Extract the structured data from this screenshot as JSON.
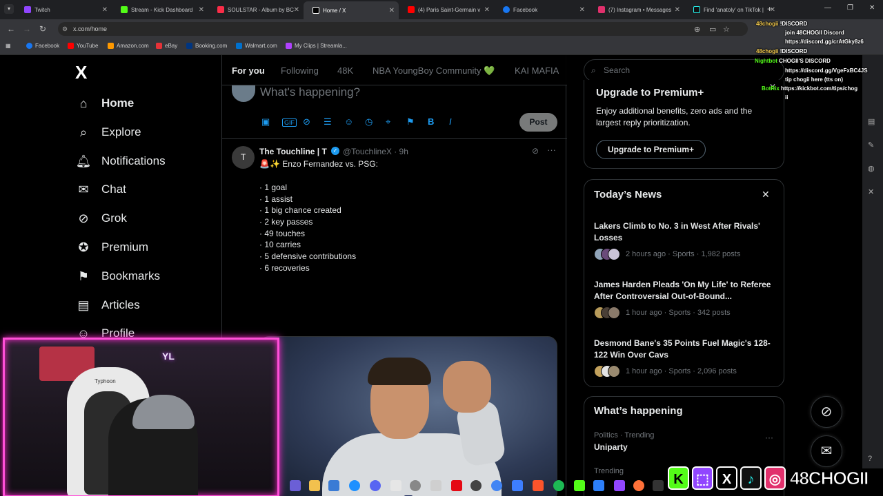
{
  "browser": {
    "tabs": [
      {
        "label": "Twitch",
        "color": "#9146ff"
      },
      {
        "label": "Stream - Kick Dashboard",
        "color": "#53fc18"
      },
      {
        "label": "SOULSTAR - Album by BC",
        "color": "#fa2d48"
      },
      {
        "label": "Home / X",
        "color": "#ffffff"
      },
      {
        "label": "(4) Paris Saint-Germain v",
        "color": "#ff0000"
      },
      {
        "label": "Facebook",
        "color": "#1877f2"
      },
      {
        "label": "(7) Instagram • Messages",
        "color": "#e1306c"
      },
      {
        "label": "Find 'anatoly' on TikTok |",
        "color": "#25f4ee"
      }
    ],
    "url": "x.com/home",
    "bookmarks": [
      {
        "label": "Facebook",
        "color": "#1877f2"
      },
      {
        "label": "YouTube",
        "color": "#ff0000"
      },
      {
        "label": "Amazon.com",
        "color": "#ff9900"
      },
      {
        "label": "eBay",
        "color": "#e53238"
      },
      {
        "label": "Booking.com",
        "color": "#003580"
      },
      {
        "label": "Walmart.com",
        "color": "#0071ce"
      },
      {
        "label": "My Clips | Streamla...",
        "color": "#b041ff"
      }
    ]
  },
  "nav": {
    "logo": "X",
    "items": [
      {
        "label": "Home",
        "icon": "⌂"
      },
      {
        "label": "Explore",
        "icon": "⌕"
      },
      {
        "label": "Notifications",
        "icon": "🔔︎"
      },
      {
        "label": "Chat",
        "icon": "✉"
      },
      {
        "label": "Grok",
        "icon": "⊘"
      },
      {
        "label": "Premium",
        "icon": "✪"
      },
      {
        "label": "Bookmarks",
        "icon": "⚑"
      },
      {
        "label": "Articles",
        "icon": "▤"
      },
      {
        "label": "Profile",
        "icon": "☺"
      }
    ]
  },
  "feed": {
    "tabs": [
      "For you",
      "Following",
      "48K",
      "NBA YoungBoy Community 💚",
      "KAI MAFIA"
    ],
    "composer_placeholder": "What's happening?",
    "composer_icons": [
      "image-icon",
      "gif-icon",
      "grok-icon",
      "poll-icon",
      "emoji-icon",
      "schedule-icon",
      "location-icon",
      "flag-icon",
      "bold-icon",
      "italic-icon"
    ],
    "post_label": "Post"
  },
  "tweet": {
    "avatar_letter": "T",
    "name": "The Touchline | T",
    "handle": "@TouchlineX · 9h",
    "headline": "🚨✨ Enzo Fernandez vs. PSG:",
    "stats": [
      "· 1 goal",
      "· 1 assist",
      "· 1 big chance created",
      "· 2 key passes",
      "· 49 touches",
      "· 10 carries",
      "· 5 defensive contributions",
      "· 6 recoveries"
    ]
  },
  "search": {
    "placeholder": "Search"
  },
  "premium": {
    "title": "Upgrade to Premium+",
    "description": "Enjoy additional benefits, zero ads and the largest reply prioritization.",
    "button": "Upgrade to Premium+"
  },
  "news": {
    "title": "Today’s News",
    "items": [
      {
        "headline": "Lakers Climb to No. 3 in West After Rivals' Losses",
        "meta": "2 hours ago · Sports · 1,982 posts"
      },
      {
        "headline": "James Harden Pleads 'On My Life' to Referee After Controversial Out-of-Bound...",
        "meta": "1 hour ago · Sports · 342 posts"
      },
      {
        "headline": "Desmond Bane's 35 Points Fuel Magic's 128-122 Win Over Cavs",
        "meta": "1 hour ago · Sports · 2,096 posts"
      }
    ]
  },
  "whats_happening": {
    "title": "What’s happening",
    "trend_meta": "Politics · Trending",
    "trend_name": "Uniparty",
    "trend2_meta": "Trending"
  },
  "stream": {
    "chat": [
      {
        "user": "48chogii",
        "text": "!DISCORD"
      },
      {
        "user": "",
        "text": "join 48CHOGII Discord"
      },
      {
        "user": "",
        "text": "https://discord.gg/crAtGky8z6"
      },
      {
        "user": "48chogii",
        "text": "!DISCORD"
      },
      {
        "user": "Nightbot",
        "text": "CHOGII'S DISCORD"
      },
      {
        "user": "",
        "text": "https://discord.gg/VgeFxBC4JS"
      },
      {
        "user": "",
        "text": "tip chogii here (tts on)"
      },
      {
        "user": "BotRix",
        "text": "https://kickbot.com/tips/chog"
      },
      {
        "user": "",
        "text": "ii"
      }
    ],
    "chair_label": "Typhoon",
    "cam_logo": "YL",
    "socials_name": "48CHOGII",
    "socials": [
      {
        "letter": "K",
        "color": "#53fc18"
      },
      {
        "letter": "⬚",
        "color": "#9146ff"
      },
      {
        "letter": "X",
        "color": "#000000"
      },
      {
        "letter": "♪",
        "color": "#111111"
      },
      {
        "letter": "◎",
        "color": "#e1306c"
      }
    ]
  },
  "colors": {
    "accent": "#1d9bf0",
    "border": "#2f3336",
    "muted": "#71767b",
    "overlay": "#ff4fd8"
  }
}
